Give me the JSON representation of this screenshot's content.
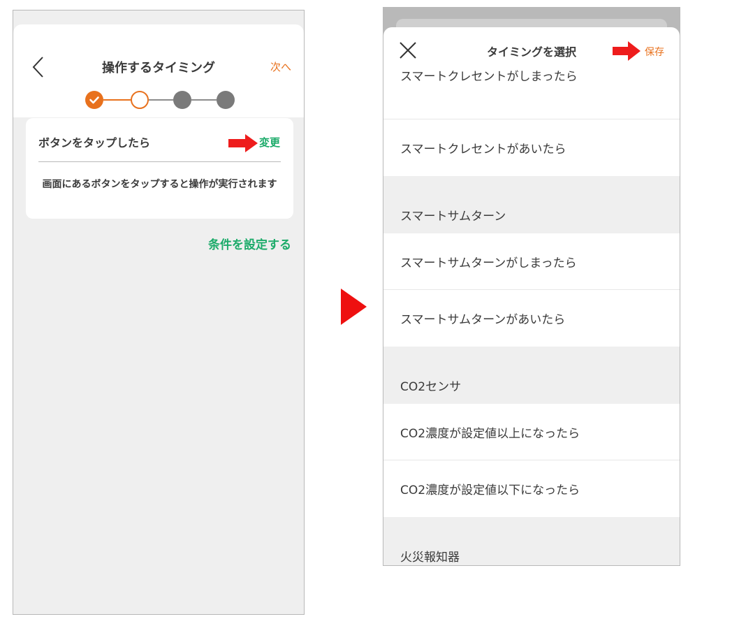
{
  "left_screen": {
    "title": "操作するタイミング",
    "next_label": "次へ",
    "trigger_label": "ボタンをタップしたら",
    "change_label": "変更",
    "trigger_description": "画面にあるボタンをタップすると操作が実行されます",
    "condition_link": "条件を設定する",
    "steps": {
      "total": 4,
      "completed": 1,
      "current": 2
    }
  },
  "right_screen": {
    "title": "タイミングを選択",
    "save_label": "保存",
    "items": [
      {
        "type": "option",
        "label": "スマートクレセントがしまったら"
      },
      {
        "type": "option",
        "label": "スマートクレセントがあいたら"
      },
      {
        "type": "section",
        "label": "スマートサムターン"
      },
      {
        "type": "option",
        "label": "スマートサムターンがしまったら"
      },
      {
        "type": "option",
        "label": "スマートサムターンがあいたら"
      },
      {
        "type": "section",
        "label": "CO2センサ"
      },
      {
        "type": "option",
        "label": "CO2濃度が設定値以上になったら"
      },
      {
        "type": "option",
        "label": "CO2濃度が設定値以下になったら"
      },
      {
        "type": "section",
        "label": "火災報知器"
      }
    ]
  },
  "colors": {
    "accent_orange": "#e8711d",
    "accent_green": "#1cab6a",
    "highlight_arrow_red": "#ee1c1c",
    "step_inactive": "#7a7a7a"
  },
  "icons": {
    "back": "chevron-left-icon",
    "close": "close-icon",
    "check": "check-icon",
    "pointer_arrow": "red-arrow-icon",
    "transition": "play-triangle-icon"
  }
}
